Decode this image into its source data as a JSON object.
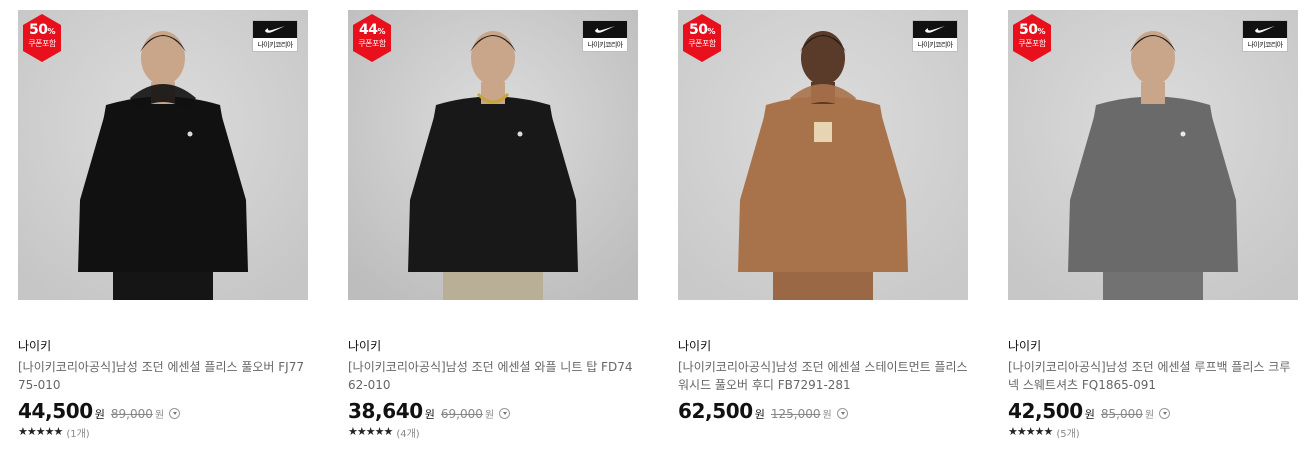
{
  "products": [
    {
      "discount_pct": "50",
      "pct_unit": "%",
      "discount_sub": "쿠폰포함",
      "logo_text": "나이키코리아",
      "seller": "나이키",
      "title": "[나이키코리아공식]남성 조던 에센셜 플리스 풀오버 FJ7775-010",
      "price": "44,500",
      "currency": "원",
      "original_price": "89,000",
      "rating_stars": "★★★★★",
      "rating_value": 5,
      "review_count": "(1개)",
      "garment_color": "#111111",
      "pants_color": "#151515",
      "background_color": "#c6c6c6"
    },
    {
      "discount_pct": "44",
      "pct_unit": "%",
      "discount_sub": "쿠폰포함",
      "logo_text": "나이키코리아",
      "seller": "나이키",
      "title": "[나이키코리아공식]남성 조던 에센셜 와플 니트 탑 FD7462-010",
      "price": "38,640",
      "currency": "원",
      "original_price": "69,000",
      "rating_stars": "★★★★★",
      "rating_value": 4.5,
      "review_count": "(4개)",
      "garment_color": "#181818",
      "pants_color": "#b9ae96",
      "background_color": "#bdbdbd"
    },
    {
      "discount_pct": "50",
      "pct_unit": "%",
      "discount_sub": "쿠폰포함",
      "logo_text": "나이키코리아",
      "seller": "나이키",
      "title": "[나이키코리아공식]남성 조던 에센셜 스테이트먼트 플리스 워시드 풀오버 후디 FB7291-281",
      "price": "62,500",
      "currency": "원",
      "original_price": "125,000",
      "rating_stars": "",
      "rating_value": 0,
      "review_count": "",
      "garment_color": "#a8724a",
      "pants_color": "#9a6844",
      "background_color": "#c9c9c9"
    },
    {
      "discount_pct": "50",
      "pct_unit": "%",
      "discount_sub": "쿠폰포함",
      "logo_text": "나이키코리아",
      "seller": "나이키",
      "title": "[나이키코리아공식]남성 조던 에센셜 루프백 플리스 크루넥 스웨트셔츠 FQ1865-091",
      "price": "42,500",
      "currency": "원",
      "original_price": "85,000",
      "rating_stars": "★★★★★",
      "rating_value": 4.5,
      "review_count": "(5개)",
      "garment_color": "#6a6a6a",
      "pants_color": "#727272",
      "background_color": "#c7c7c7"
    }
  ],
  "colors": {
    "badge": "#e8101c",
    "price": "#111111",
    "muted": "#888888"
  }
}
